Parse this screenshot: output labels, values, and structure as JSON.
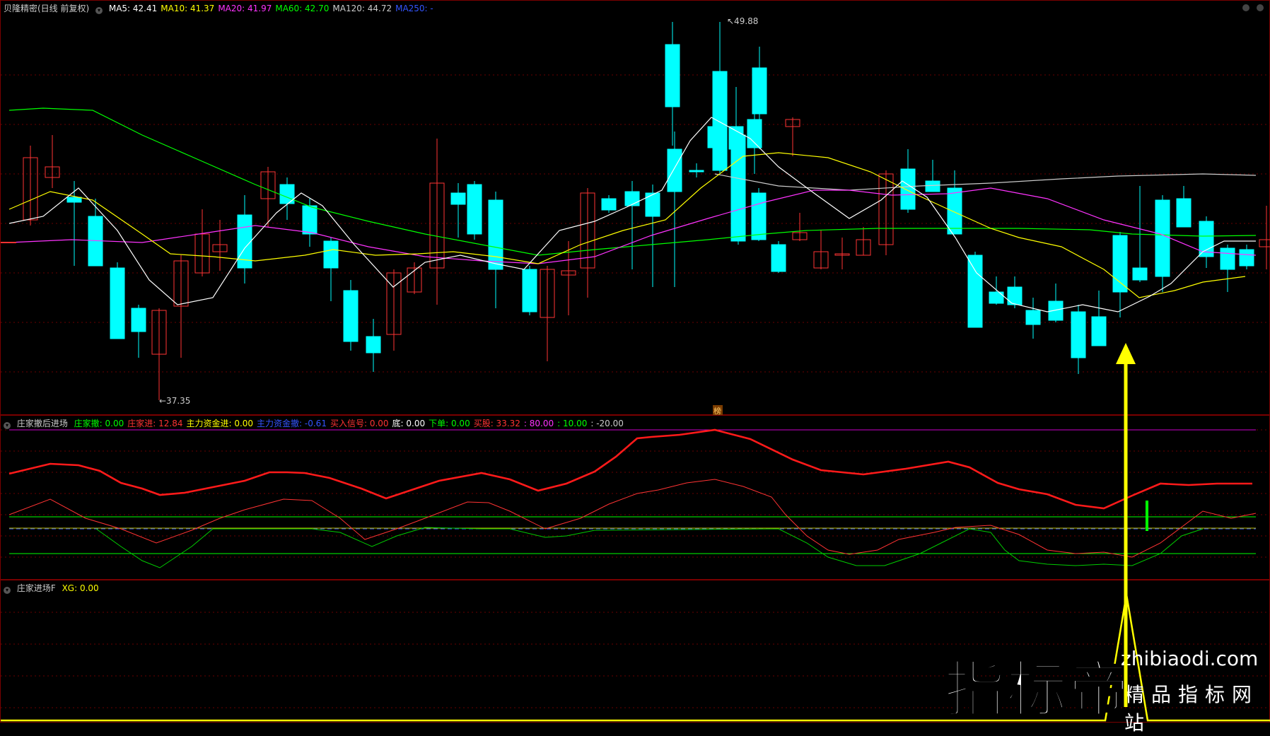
{
  "main_panel": {
    "title": "贝隆精密(日线 前复权)",
    "ma": [
      {
        "label": "MA5: 42.41",
        "color": "#ffffff"
      },
      {
        "label": "MA10: 41.37",
        "color": "#ffff00"
      },
      {
        "label": "MA20: 41.97",
        "color": "#ff33ff"
      },
      {
        "label": "MA60: 42.70",
        "color": "#00ff00"
      },
      {
        "label": "MA120: 44.72",
        "color": "#cccccc"
      },
      {
        "label": "MA250: -",
        "color": "#3355ff"
      }
    ],
    "high_label": "49.88",
    "low_label": "37.35",
    "marker_label": "榜"
  },
  "indicator_panel": {
    "title": "庄家撤后进场",
    "items": [
      {
        "label": "庄家撤: 0.00",
        "color": "#00ff00"
      },
      {
        "label": "庄家进: 12.84",
        "color": "#ff3333"
      },
      {
        "label": "主力资金进: 0.00",
        "color": "#ffff00"
      },
      {
        "label": "主力资金撤: -0.61",
        "color": "#3355ff"
      },
      {
        "label": "买入信号: 0.00",
        "color": "#ff3333"
      },
      {
        "label": "底: 0.00",
        "color": "#ffffff"
      },
      {
        "label": "下单: 0.00",
        "color": "#00ff00"
      },
      {
        "label": "买股: 33.32",
        "color": "#ff3333"
      },
      {
        "label": ": 80.00",
        "color": "#ff33ff"
      },
      {
        "label": ": 10.00",
        "color": "#00ff00"
      },
      {
        "label": ": -20.00",
        "color": "#cccccc"
      }
    ]
  },
  "signal_panel": {
    "title": "庄家进场F",
    "items": [
      {
        "label": "XG: 0.00",
        "color": "#ffff00"
      }
    ]
  },
  "watermark": {
    "main": "指标帝",
    "url": "zhibiaodi.com",
    "sub": "精品指标网站"
  }
}
